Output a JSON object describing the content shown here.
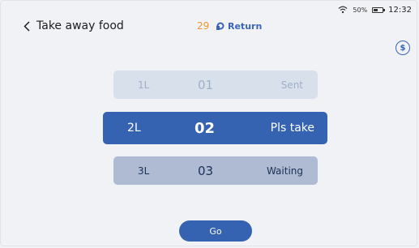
{
  "status_bar": {
    "battery": "50%",
    "time": "12:32"
  },
  "header": {
    "title": "Take away food",
    "count": "29",
    "return_label": "Return"
  },
  "info_icon_glyph": "$",
  "rows": [
    {
      "layer": "1L",
      "number": "01",
      "status": "Sent"
    },
    {
      "layer": "2L",
      "number": "02",
      "status": "Pls take"
    },
    {
      "layer": "3L",
      "number": "03",
      "status": "Waiting"
    }
  ],
  "action": {
    "go_label": "Go"
  },
  "colors": {
    "accent": "#3563b2",
    "count": "#f0952f",
    "background": "#f1f2f6"
  }
}
